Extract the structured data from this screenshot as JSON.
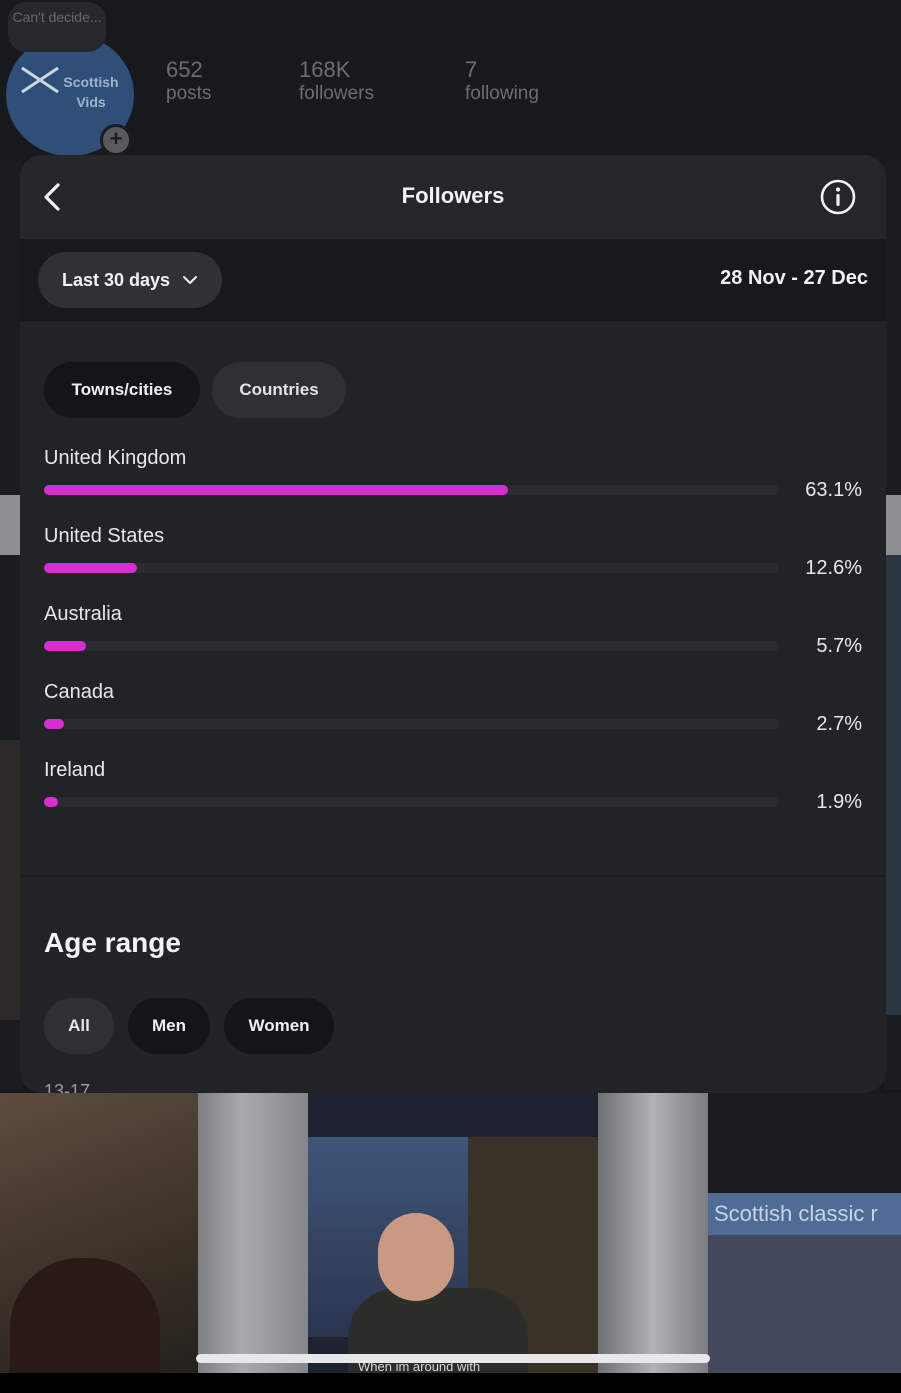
{
  "profile": {
    "note": "Can't decide...",
    "avatar_text": "Scottish Vids",
    "posts_count": "652",
    "posts_label": "posts",
    "followers_count": "168K",
    "followers_label": "followers",
    "following_count": "7",
    "following_label": "following"
  },
  "sheet": {
    "title": "Followers",
    "range_label": "Last 30 days",
    "date_range": "28 Nov - 27 Dec"
  },
  "location": {
    "tabs": [
      {
        "label": "Towns/cities",
        "active": true
      },
      {
        "label": "Countries",
        "active": false
      }
    ],
    "rows": [
      {
        "name": "United Kingdom",
        "percent_text": "63.1%",
        "value": 63.1
      },
      {
        "name": "United States",
        "percent_text": "12.6%",
        "value": 12.6
      },
      {
        "name": "Australia",
        "percent_text": "5.7%",
        "value": 5.7
      },
      {
        "name": "Canada",
        "percent_text": "2.7%",
        "value": 2.7
      },
      {
        "name": "Ireland",
        "percent_text": "1.9%",
        "value": 1.9
      }
    ]
  },
  "age": {
    "title": "Age range",
    "filters": [
      {
        "label": "All"
      },
      {
        "label": "Men"
      },
      {
        "label": "Women"
      }
    ],
    "first_row_label": "13-17"
  },
  "grid": {
    "banner_text": "Scottish classic r",
    "caption_text": "When im around with"
  },
  "colors": {
    "bar_fill": "#d62fd0",
    "sheet_bg": "#222327"
  }
}
